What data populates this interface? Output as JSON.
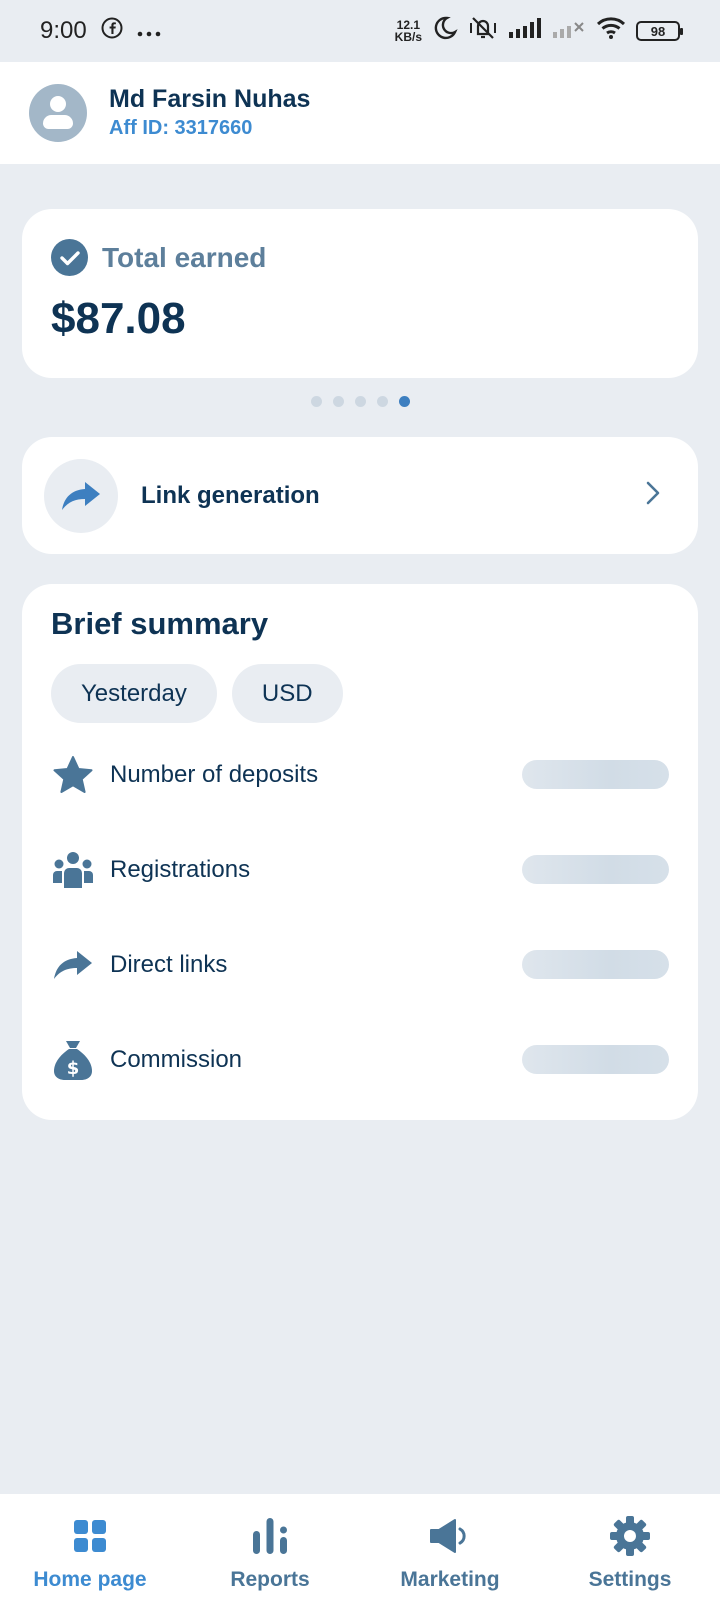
{
  "status_bar": {
    "time": "9:00",
    "network_speed_value": "12.1",
    "network_speed_unit": "KB/s",
    "battery": "98",
    "icons": [
      "facebook-icon",
      "more-icon",
      "moon-icon",
      "vibrate-off-icon",
      "signal-icon",
      "signal-off-icon",
      "wifi-icon",
      "battery-icon"
    ]
  },
  "header": {
    "user_name": "Md Farsin Nuhas",
    "aff_id": "Aff ID: 3317660"
  },
  "earned_card": {
    "label": "Total earned",
    "value": "$87.08",
    "carousel_dots": 5,
    "active_dot": 5
  },
  "link_card": {
    "label": "Link generation"
  },
  "summary": {
    "title": "Brief summary",
    "filters": [
      "Yesterday",
      "USD"
    ],
    "metrics": [
      {
        "label": "Number of deposits",
        "icon": "star-icon"
      },
      {
        "label": "Registrations",
        "icon": "users-icon"
      },
      {
        "label": "Direct links",
        "icon": "share-arrow-icon"
      },
      {
        "label": "Commission",
        "icon": "money-bag-icon"
      }
    ]
  },
  "bottom_nav": {
    "items": [
      {
        "label": "Home page",
        "icon": "home-grid-icon",
        "active": true
      },
      {
        "label": "Reports",
        "icon": "bar-chart-icon",
        "active": false
      },
      {
        "label": "Marketing",
        "icon": "megaphone-icon",
        "active": false
      },
      {
        "label": "Settings",
        "icon": "gear-icon",
        "active": false
      }
    ]
  },
  "colors": {
    "primary_dark": "#0e3354",
    "accent_blue": "#3d8bd1",
    "muted_blue": "#4a7597",
    "background": "#e9edf2"
  }
}
